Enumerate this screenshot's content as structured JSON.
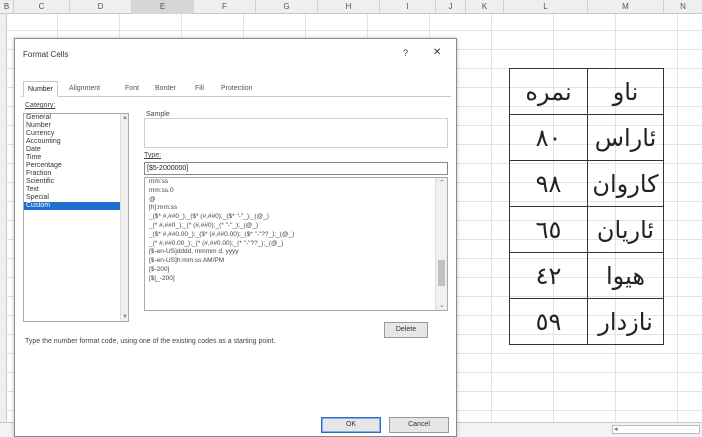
{
  "sheet": {
    "columns": [
      "B",
      "C",
      "D",
      "E",
      "F",
      "G",
      "H",
      "I",
      "J",
      "K",
      "L",
      "M",
      "N"
    ],
    "selected_column": "E",
    "table": [
      [
        "نمره",
        "ناو"
      ],
      [
        "٨٠",
        "ئاراس"
      ],
      [
        "٩٨",
        "كاروان"
      ],
      [
        "٦٥",
        "ئاريان"
      ],
      [
        "٤٢",
        "هيوا"
      ],
      [
        "٥٩",
        "نازدار"
      ]
    ]
  },
  "dialog": {
    "title": "Format Cells",
    "help": "?",
    "close": "✕",
    "tabs": [
      "Number",
      "Alignment",
      "Font",
      "Border",
      "Fill",
      "Protection"
    ],
    "active_tab": "Number",
    "category_label": "Category:",
    "categories": [
      "General",
      "Number",
      "Currency",
      "Accounting",
      "Date",
      "Time",
      "Percentage",
      "Fraction",
      "Scientific",
      "Text",
      "Special",
      "Custom"
    ],
    "selected_category": "Custom",
    "sample_label": "Sample",
    "type_label": "Type:",
    "type_value": "[$5-2000000]",
    "format_list": [
      "mm:ss",
      "mm:ss.0",
      "@",
      "[h]:mm:ss",
      "_($* #,##0_);_($* (#,##0);_($* \"-\"_);_(@_)",
      "_(* #,##0_);_(* (#,##0);_(* \"-\"_);_(@_)",
      "_($* #,##0.00_);_($* (#,##0.00);_($* \"-\"??_);_(@_)",
      "_(* #,##0.00_);_(* (#,##0.00);_(* \"-\"??_);_(@_)",
      "[$-en-US]dddd, mmmm d, yyyy",
      "[$-en-US]h:mm:ss AM/PM",
      "[$-200]",
      "[$[_-200]"
    ],
    "delete_label": "Delete",
    "hint": "Type the number format code, using one of the existing codes as a starting point.",
    "ok_label": "OK",
    "cancel_label": "Cancel"
  }
}
